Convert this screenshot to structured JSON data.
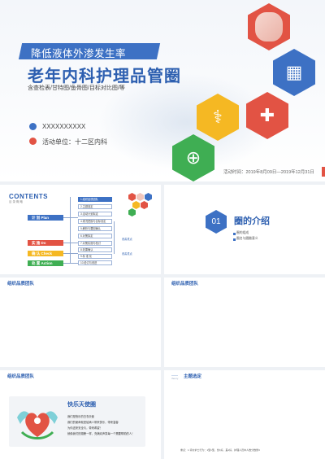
{
  "cover": {
    "subtitle": "降低液体外渗发生率",
    "title": "老年内科护理品管圈",
    "tools": "含查检表/甘特图/鱼骨图/目标对比图/等",
    "person": "XXXXXXXXXX",
    "unit_label": "活动单位：十二区内科",
    "date_label": "活动时间：2019年8月09日—2019年12月31日",
    "hex_icons": [
      {
        "name": "massage-photo",
        "color": "#e25344"
      },
      {
        "name": "hospital-icon",
        "color": "#3d71c4"
      },
      {
        "name": "caduceus-icon",
        "color": "#f5b823"
      },
      {
        "name": "first-aid-kit-icon",
        "color": "#e25344"
      },
      {
        "name": "globe-stethoscope-icon",
        "color": "#3fae53"
      }
    ],
    "hex_glyphs": [
      "",
      "▦",
      "⚕",
      "✚",
      "⊕"
    ]
  },
  "contents": {
    "logo": "CONTENTS",
    "sub": "目 录 概 略",
    "phases": [
      {
        "label": "计 划 Plan",
        "color": "#3d71c4"
      },
      {
        "label": "实 施 Do",
        "color": "#e25344"
      },
      {
        "label": "确 认 Check",
        "color": "#f5b823"
      },
      {
        "label": "处 置 Action",
        "color": "#3fae53"
      }
    ],
    "steps": [
      "1.组织品质团队",
      "2.主题选定",
      "3.活动计划拟定",
      "4.现况把握与目标设定",
      "5.解析与要因确认",
      "6.对策拟定",
      "7.对策实施与检讨",
      "8.效果确认",
      "9.标 准 化",
      "10.检讨与改进"
    ],
    "tags": [
      "改善重点",
      "改善重点"
    ]
  },
  "section": {
    "number": "01",
    "title": "圈的介绍",
    "bullets": [
      "圈的组成",
      "圈名与圈徽意义"
    ]
  },
  "slides": {
    "team_a": "组织品质团队",
    "team_b": "组织品质团队",
    "team_c": "组织品质团队",
    "theme_tag": "——",
    "theme_sub": "theory",
    "theme": "主题选定"
  },
  "angel": {
    "name": "快乐天使圈",
    "lines": [
      "我们是快乐的白衣天使",
      "我们的使命就是给病人带来快乐，带来温馨",
      "为你送来安全与，带来希望！",
      "就像我们的翅膀一样，充满欢声笑每一个需要帮助的人！"
    ]
  },
  "theme_note": "重点：1.评价护士行为：1型1型，优1好，差1好，护理人员中人数分数整3"
}
